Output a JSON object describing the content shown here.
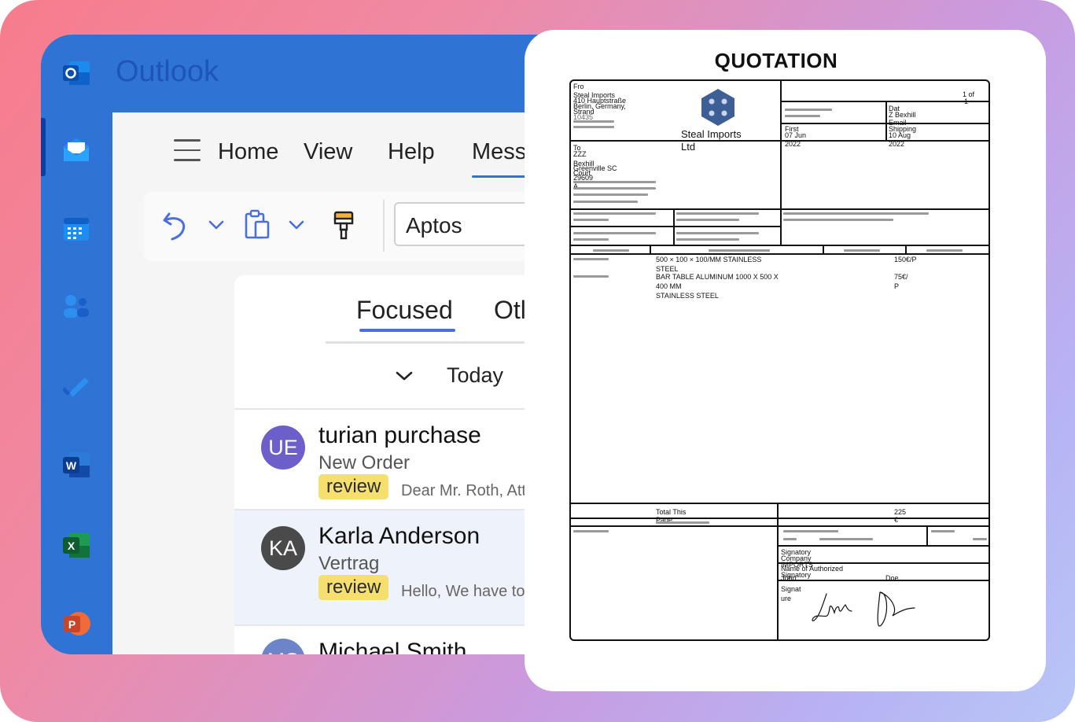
{
  "app": {
    "name": "Outlook"
  },
  "nav": {
    "icons": [
      "outlook-logo-icon",
      "mail-icon",
      "calendar-icon",
      "people-icon",
      "todo-icon",
      "word-icon",
      "excel-icon",
      "powerpoint-icon"
    ]
  },
  "menu": {
    "tabs": [
      {
        "label": "Home"
      },
      {
        "label": "View"
      },
      {
        "label": "Help"
      },
      {
        "label": "Mess"
      }
    ],
    "active": "Mess"
  },
  "ribbon": {
    "font": "Aptos"
  },
  "inbox": {
    "tabs": [
      {
        "label": "Focused"
      },
      {
        "label": "Otl"
      }
    ],
    "group": "Today",
    "messages": [
      {
        "initials": "UE",
        "sender": "turian purchase",
        "subject": "New Order",
        "tag": "review",
        "preview": "Dear Mr. Roth, Att",
        "avatar_color": "#6c5fc9"
      },
      {
        "initials": "KA",
        "sender": "Karla Anderson",
        "subject": "Vertrag",
        "tag": "review",
        "preview": "Hello, We have to",
        "avatar_color": "#4a4a4a"
      },
      {
        "initials": "MS",
        "sender": "Michael Smith",
        "avatar_color": "#6c85c9"
      }
    ]
  },
  "quotation": {
    "title": "QUOTATION",
    "from_label": "Fro",
    "from_lines": [
      "Steal Imports",
      "410 Hauptstraße",
      "Berlin, Germany,",
      "Strand",
      "10435"
    ],
    "logo_name_1": "Steal Imports",
    "logo_name_2": "Ltd",
    "page": "1 of",
    "page_total": "1",
    "date_label": "Dat",
    "date_value": "Z Bexhill",
    "email_label": "Email",
    "first_label": "First",
    "first_value": "07 Jun",
    "first_year": "2022",
    "shipping_label": "Shipping",
    "shipping_value": "10 Aug",
    "shipping_year": "2022",
    "to_label": "To",
    "to_lines": [
      "ZZZ",
      "Bexhill",
      "Greenville SC",
      "Court",
      "29609",
      "A"
    ],
    "items": [
      {
        "desc1": "500 × 100 × 100/MM STAINLESS",
        "desc2": "STEEL",
        "price1": "150€/P",
        "price2": ""
      },
      {
        "desc1": "BAR TABLE ALUMINUM 1000 X 500 X",
        "desc2": "400 MM",
        "desc3": "STAINLESS STEEL",
        "price1": "75€/",
        "price2": "P"
      }
    ],
    "total_label": "Total This",
    "total_label2": "Page",
    "total_value": "225",
    "total_currency": "€",
    "signatory_label": "Signatory",
    "company_label": "Company",
    "company_value": "IMPORTS",
    "authorized_label": "Name of Authorized",
    "authorized_label2": "Signatory",
    "name_value": "John",
    "surname_value": "Doe",
    "signature_label": "Signat",
    "signature_label2": "ure"
  }
}
